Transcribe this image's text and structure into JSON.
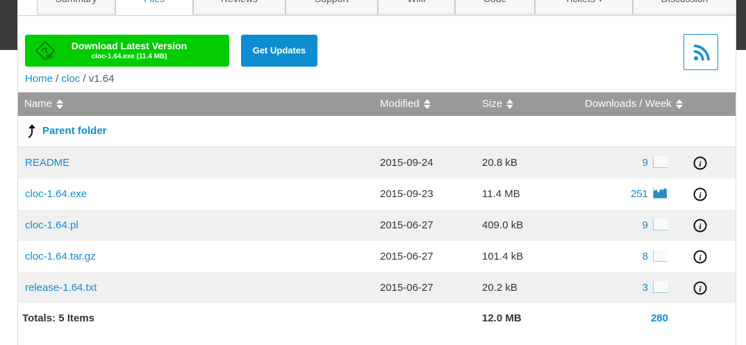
{
  "tabs": [
    {
      "label": "Summary"
    },
    {
      "label": "Files"
    },
    {
      "label": "Reviews"
    },
    {
      "label": "Support"
    },
    {
      "label": "Wiki"
    },
    {
      "label": "Code"
    },
    {
      "label": "Tickets ▾"
    },
    {
      "label": "Discussion"
    }
  ],
  "download": {
    "title": "Download Latest Version",
    "subtitle": "cloc-1.64.exe (11.4 MB)"
  },
  "get_updates": "Get Updates",
  "breadcrumb": {
    "home": "Home",
    "sep1": " / ",
    "project": "cloc",
    "sep2": " / ",
    "current": "v1.64"
  },
  "table": {
    "headers": {
      "name": "Name",
      "modified": "Modified",
      "size": "Size",
      "downloads": "Downloads / Week"
    },
    "parent_folder": "Parent folder",
    "rows": [
      {
        "name": "README",
        "modified": "2015-09-24",
        "size": "20.8 kB",
        "downloads": "9"
      },
      {
        "name": "cloc-1.64.exe",
        "modified": "2015-09-23",
        "size": "11.4 MB",
        "downloads": "251"
      },
      {
        "name": "cloc-1.64.pl",
        "modified": "2015-06-27",
        "size": "409.0 kB",
        "downloads": "9"
      },
      {
        "name": "cloc-1.64.tar.gz",
        "modified": "2015-06-27",
        "size": "101.4 kB",
        "downloads": "8"
      },
      {
        "name": "release-1.64.txt",
        "modified": "2015-06-27",
        "size": "20.2 kB",
        "downloads": "3"
      }
    ],
    "totals": {
      "label": "Totals: 5 Items",
      "size": "12.0 MB",
      "downloads": "280"
    }
  },
  "colors": {
    "link": "#0e8ed1",
    "download_green": "#00cc00",
    "header_gray": "#999999"
  }
}
